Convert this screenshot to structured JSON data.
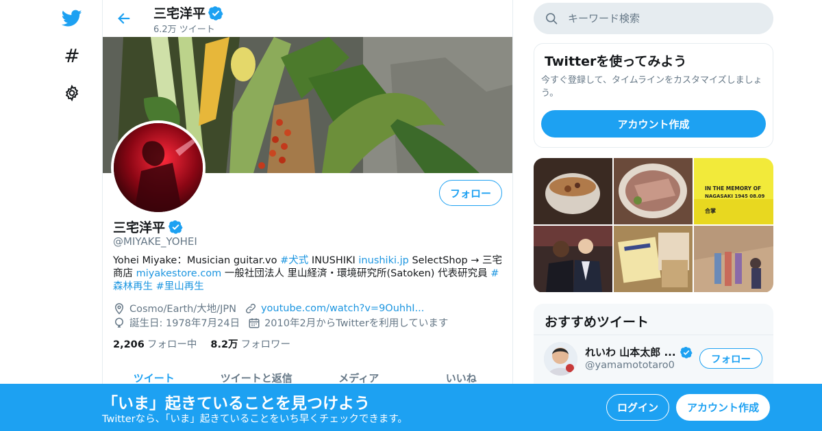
{
  "colors": {
    "accent": "#1da1f2",
    "text": "#14171a",
    "muted": "#657786",
    "link": "#1b95e0"
  },
  "nav": {
    "icons": [
      "twitter-bird-icon",
      "hashtag-icon",
      "gear-icon"
    ],
    "hash_glyph": "#"
  },
  "header": {
    "name": "三宅洋平",
    "tweet_count": "6.2万 ツイート"
  },
  "profile": {
    "name": "三宅洋平",
    "handle": "@MIYAKE_YOHEI",
    "follow_label": "フォロー",
    "bio": {
      "t1": "Yohei Miyake：Musician guitar.vo ",
      "tag1": "#犬式",
      "t2": " INUSHIKI ",
      "link1": "inushiki.jp",
      "t3": " SelectShop → 三宅商店 ",
      "link2": "miyakestore.com",
      "t4": " 一般社団法人 里山経済・環境研究所(Satoken) 代表研究員 ",
      "tag2": "#森林再生",
      "t5": " ",
      "tag3": "#里山再生"
    },
    "location": "Cosmo/Earth/大地/JPN",
    "website": "youtube.com/watch?v=9OuhhI...",
    "birthday": "誕生日: 1978年7月24日",
    "joined": "2010年2月からTwitterを利用しています",
    "following_count": "2,206",
    "following_label": "フォロー中",
    "followers_count": "8.2万",
    "followers_label": "フォロワー"
  },
  "tabs": [
    "ツイート",
    "ツイートと返信",
    "メディア",
    "いいね"
  ],
  "search": {
    "placeholder": "キーワード検索"
  },
  "signup_card": {
    "title": "Twitterを使ってみよう",
    "subtitle": "今すぐ登録して、タイムラインをカスタマイズしましょう。",
    "button": "アカウント作成"
  },
  "media_grid": {
    "tile3_line1": "IN THE MEMORY OF",
    "tile3_line2": "NAGASAKI 1945 08.09",
    "tile3_line3": "合掌"
  },
  "recommended": {
    "title": "おすすめツイート",
    "name": "れいわ 山本太郎 ...",
    "handle": "@yamamototaro0",
    "follow_label": "フォロー"
  },
  "bottom_bar": {
    "title": "「いま」起きていることを見つけよう",
    "subtitle": "Twitterなら、「いま」起きていることをいち早くチェックできます。",
    "login": "ログイン",
    "signup": "アカウント作成"
  }
}
